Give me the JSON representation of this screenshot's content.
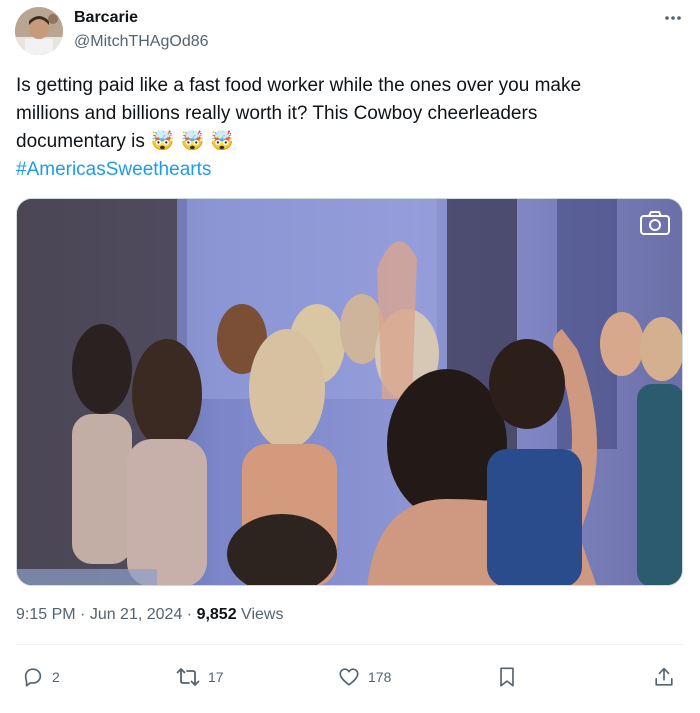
{
  "author": {
    "display_name": "Barcarie",
    "handle": "@MitchTHAgOd86",
    "avatar_icon": "profile-photo"
  },
  "tweet": {
    "text_lines": [
      "Is getting paid like a fast food worker while the ones over you make",
      "millions and billions really worth it? This Cowboy cheerleaders",
      "documentary is"
    ],
    "emoji": [
      "🤯",
      "🤯",
      "🤯"
    ],
    "hashtag": "#AmericasSweethearts"
  },
  "media": {
    "type": "photo",
    "overlay_icon": "camera-icon"
  },
  "meta": {
    "time": "9:15 PM",
    "separator": " · ",
    "date": "Jun 21, 2024",
    "views_count": "9,852",
    "views_label": " Views"
  },
  "actions": {
    "replies": "2",
    "retweets": "17",
    "likes": "178"
  },
  "colors": {
    "link": "#1d9bf0",
    "secondary_text": "#536471",
    "primary_text": "#0f1419"
  }
}
